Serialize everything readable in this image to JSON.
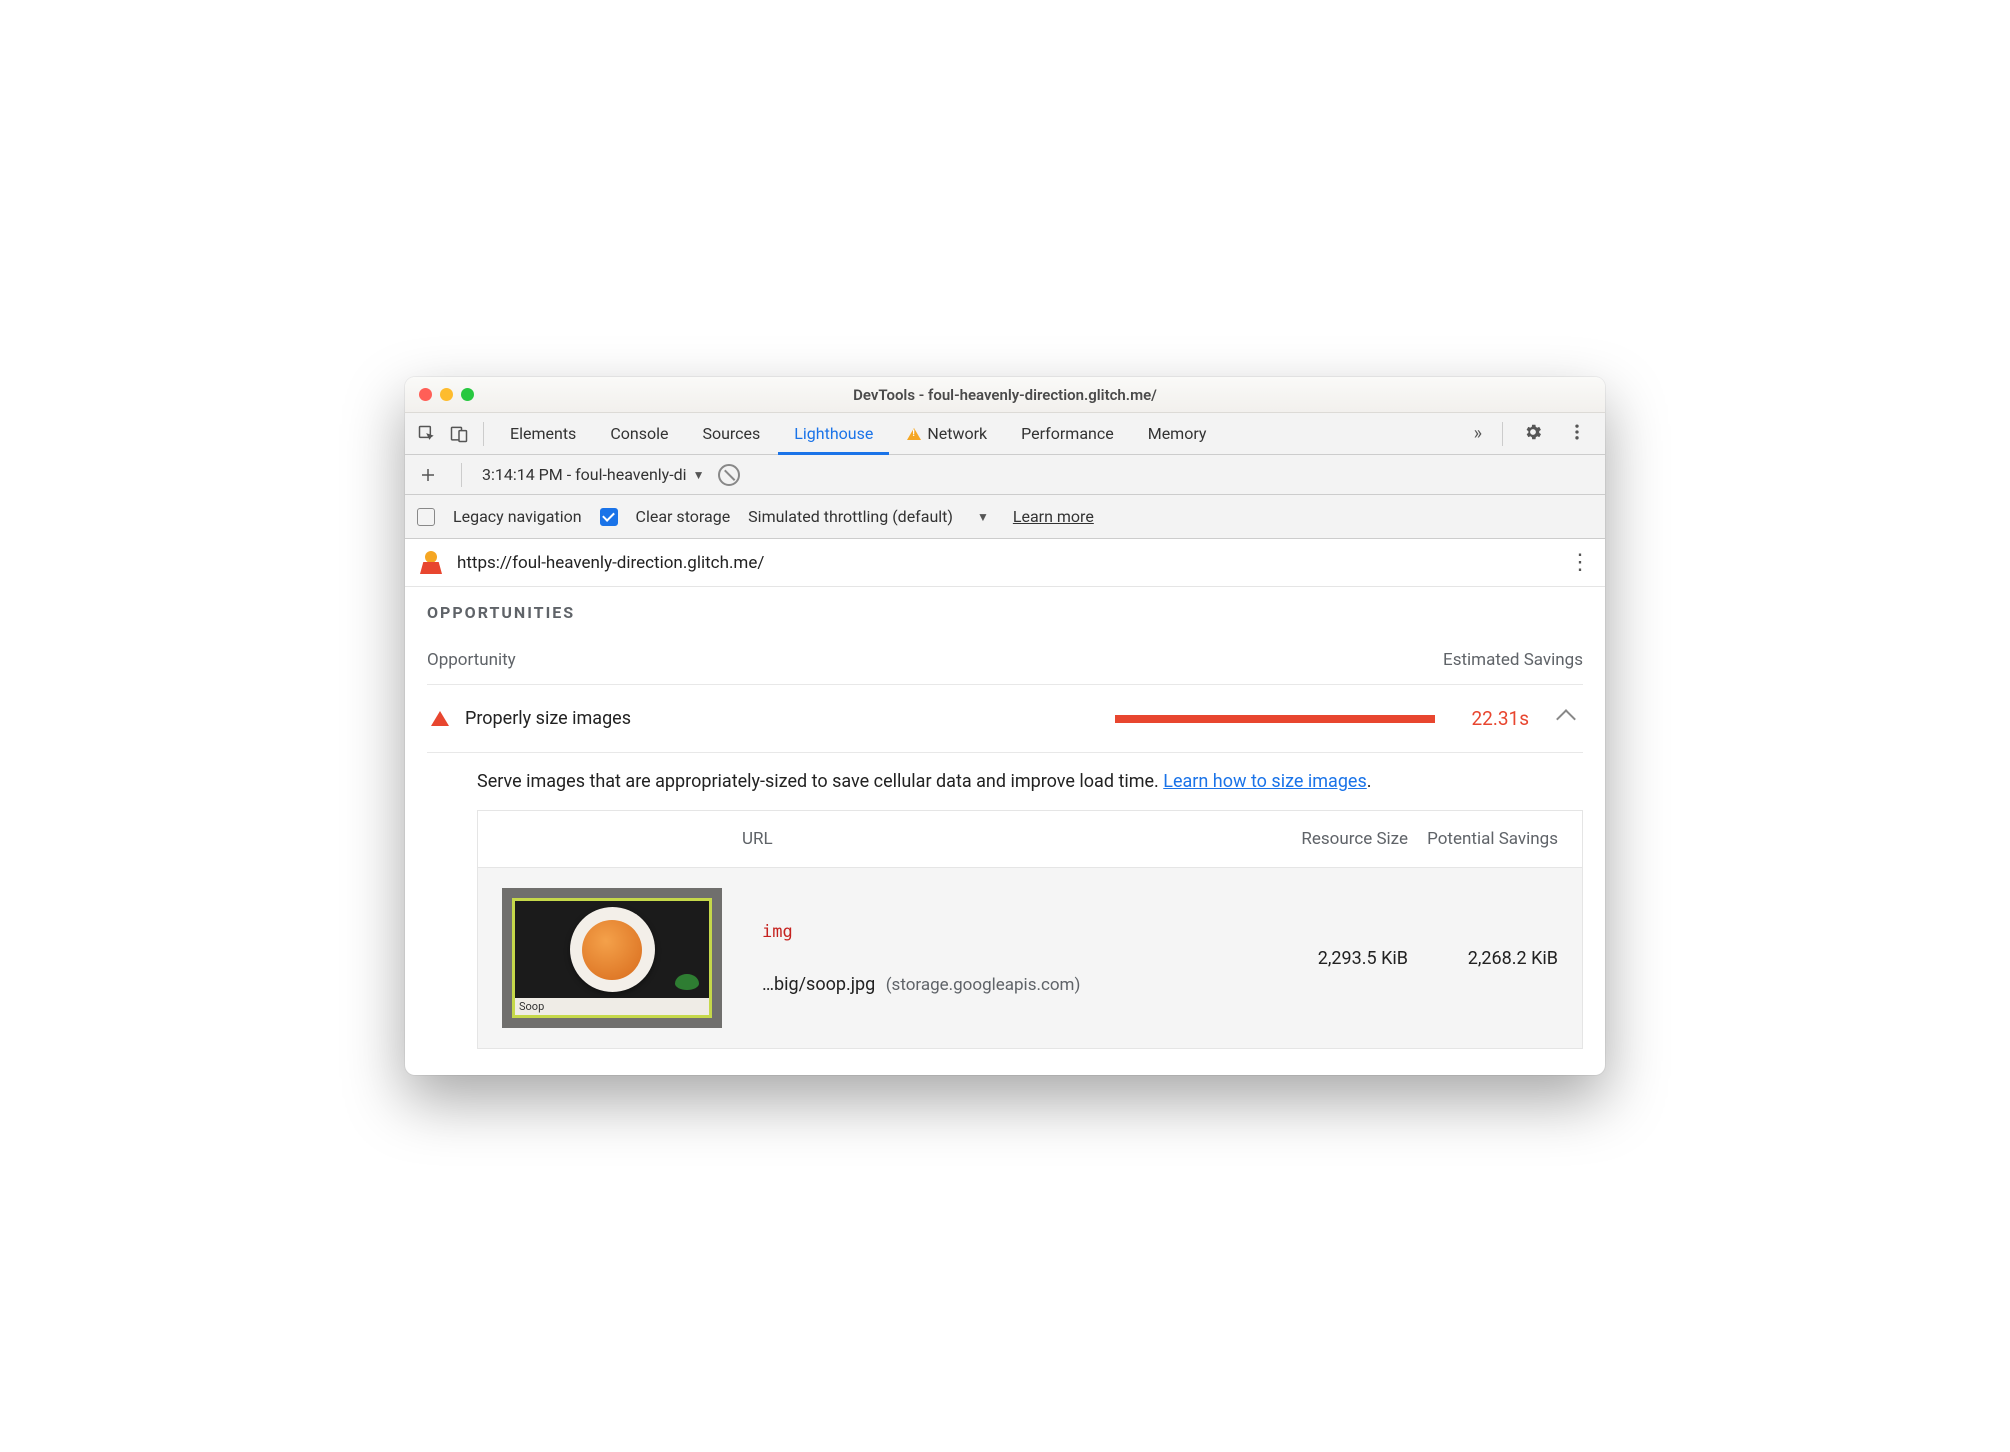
{
  "window": {
    "title": "DevTools - foul-heavenly-direction.glitch.me/"
  },
  "tabs": {
    "items": [
      "Elements",
      "Console",
      "Sources",
      "Lighthouse",
      "Network",
      "Performance",
      "Memory"
    ],
    "active": "Lighthouse",
    "network_warning": true
  },
  "toolbar": {
    "report_label": "3:14:14 PM - foul-heavenly-di"
  },
  "options": {
    "legacy_label": "Legacy navigation",
    "legacy_checked": false,
    "clear_label": "Clear storage",
    "clear_checked": true,
    "throttling_label": "Simulated throttling (default)",
    "learn_more": "Learn more"
  },
  "urlbar": {
    "url": "https://foul-heavenly-direction.glitch.me/"
  },
  "section": {
    "title": "OPPORTUNITIES",
    "col_opp": "Opportunity",
    "col_sav": "Estimated Savings"
  },
  "opportunity": {
    "label": "Properly size images",
    "savings": "22.31s",
    "description_pre": "Serve images that are appropriately-sized to save cellular data and improve load time. ",
    "description_link": "Learn how to size images",
    "description_post": "."
  },
  "table": {
    "head_url": "URL",
    "head_size": "Resource Size",
    "head_pot": "Potential Savings",
    "rows": [
      {
        "tag": "img",
        "path": "…big/soop.jpg",
        "host": "(storage.googleapis.com)",
        "size": "2,293.5 KiB",
        "potential": "2,268.2 KiB",
        "caption": "Soop"
      }
    ]
  }
}
